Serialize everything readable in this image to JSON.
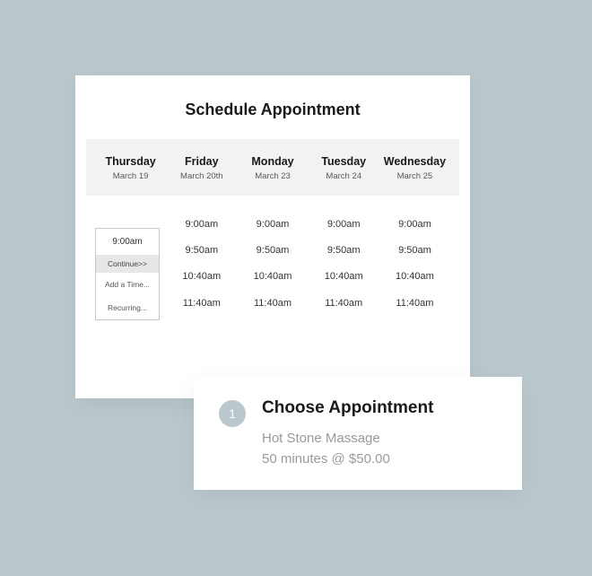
{
  "schedule": {
    "title": "Schedule Appointment",
    "days": [
      {
        "label": "Thursday",
        "sub": "March 19"
      },
      {
        "label": "Friday",
        "sub": "March 20th"
      },
      {
        "label": "Monday",
        "sub": "March 23"
      },
      {
        "label": "Tuesday",
        "sub": "March 24"
      },
      {
        "label": "Wednesday",
        "sub": "March 25"
      }
    ],
    "times_first_col": [
      "9:00am"
    ],
    "times_other_cols": [
      "9:00am",
      "9:50am",
      "10:40am",
      "11:40am"
    ]
  },
  "popover": {
    "selected_time": "9:00am",
    "continue_label": "Continue>>",
    "add_time_label": "Add a Time...",
    "recurring_label": "Recurring..."
  },
  "choose": {
    "step": "1",
    "title": "Choose Appointment",
    "service": "Hot Stone Massage",
    "details": "50 minutes @ $50.00"
  }
}
